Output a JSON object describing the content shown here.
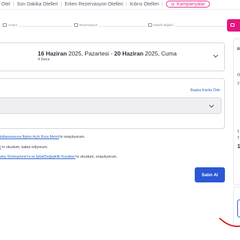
{
  "nav": {
    "links": [
      "Otel",
      "Son Dakika Otelleri",
      "Erken Rezervasyon Otelleri",
      "Kıbrıs Otelleri"
    ],
    "campaign_label": "Kampanyalar"
  },
  "steps": [
    {
      "label": "Araştır",
      "icon": "search-icon"
    },
    {
      "label": "Rezervasyon",
      "icon": "calendar-icon"
    },
    {
      "label": "Misafir Bilgileri",
      "icon": "user-icon"
    }
  ],
  "booking": {
    "checkin_day_month": "16 Haziran",
    "checkin_rest": " 2025, Pazartesi - ",
    "checkout_day_month": "20 Haziran",
    "checkout_rest": " 2025, Cuma",
    "nights": "4 Gece"
  },
  "payment": {
    "other_card_link": "Başka Kartla Öde"
  },
  "consents": [
    {
      "link": "kitlanmasına İlişkin Açık Rıza Metni",
      "suffix": "'ni onaylıyorum."
    },
    {
      "link": "ı",
      "suffix": "'nı okudum, kabul ediyorum."
    },
    {
      "link": "atış Sözleşmesi'ni ve İptal/Değişiklik Kuralları",
      "suffix": "'nı okudum, onaylıyorum."
    }
  ],
  "buy_button": "Satın Al",
  "sidebar": {
    "row1": "R",
    "row2": "Ö",
    "row3": "2",
    "row4": "1",
    "row5": "T",
    "row6": "1"
  },
  "colors": {
    "accent": "#e5157f",
    "primary_button": "#2c58d6",
    "link": "#2f63c8"
  }
}
